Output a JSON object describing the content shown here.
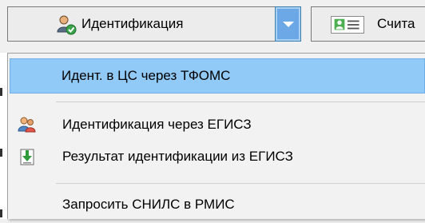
{
  "toolbar": {
    "identify_label": "Идентификация",
    "second_label": "Счита"
  },
  "menu": {
    "items": [
      {
        "label": "Идент. в ЦС через ТФОМС",
        "icon": "none"
      },
      {
        "label": "Идентификация через ЕГИСЗ",
        "icon": "users-icon"
      },
      {
        "label": "Результат идентификации из ЕГИСЗ",
        "icon": "download-result-icon"
      },
      {
        "label": "Запросить СНИЛС в РМИС",
        "icon": "none"
      }
    ]
  },
  "colors": {
    "highlight": "#91c9f7",
    "dropdown_active": "#6ba8e5"
  }
}
